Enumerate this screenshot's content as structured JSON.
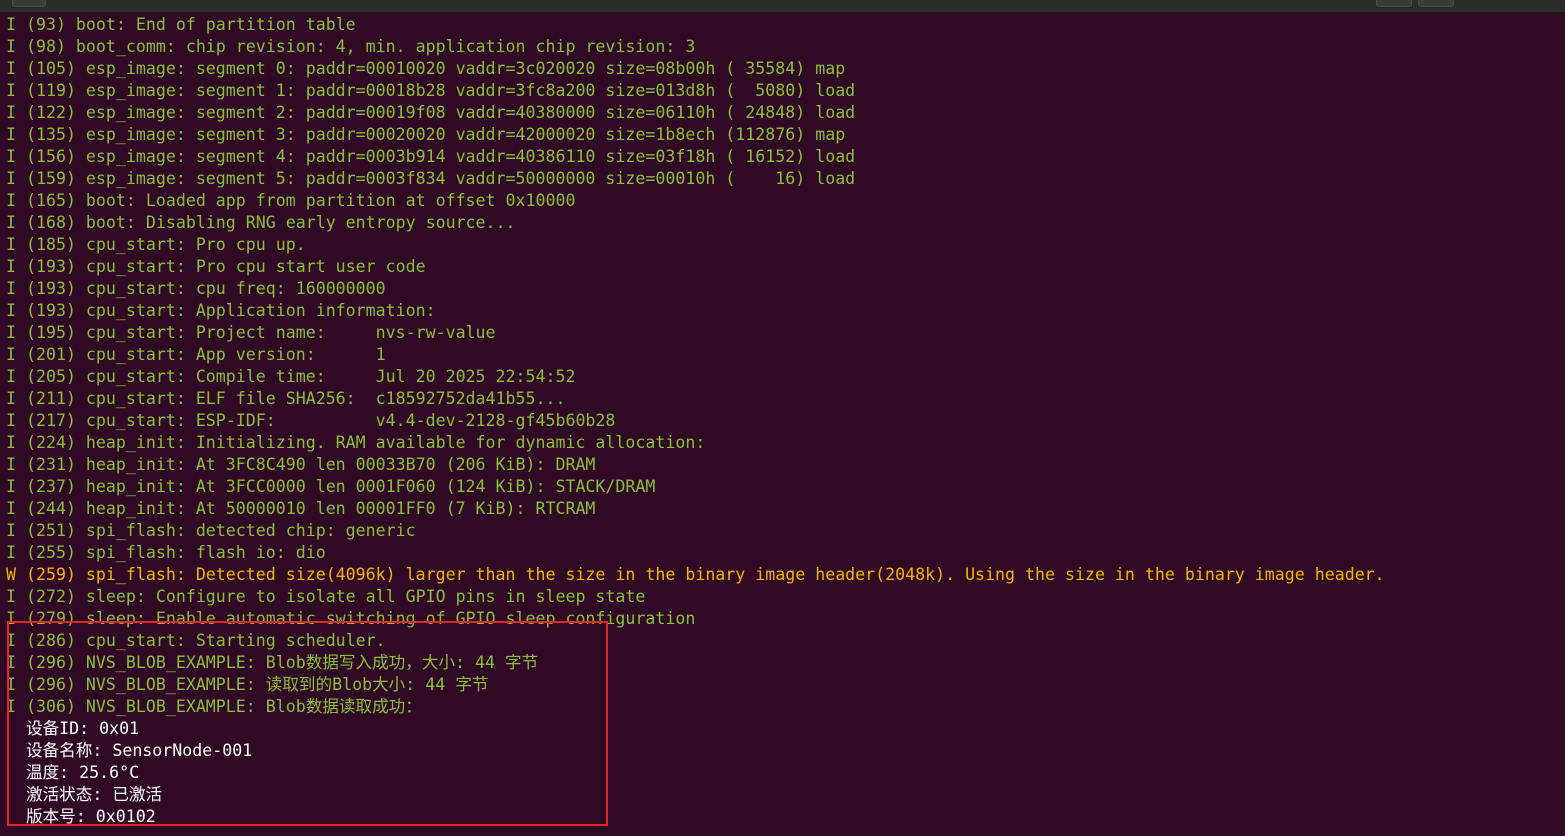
{
  "terminal": {
    "lines": [
      {
        "text": "I (93) boot: End of partition table",
        "level": "info"
      },
      {
        "text": "I (98) boot_comm: chip revision: 4, min. application chip revision: 3",
        "level": "info"
      },
      {
        "text": "I (105) esp_image: segment 0: paddr=00010020 vaddr=3c020020 size=08b00h ( 35584) map",
        "level": "info"
      },
      {
        "text": "I (119) esp_image: segment 1: paddr=00018b28 vaddr=3fc8a200 size=013d8h (  5080) load",
        "level": "info"
      },
      {
        "text": "I (122) esp_image: segment 2: paddr=00019f08 vaddr=40380000 size=06110h ( 24848) load",
        "level": "info"
      },
      {
        "text": "I (135) esp_image: segment 3: paddr=00020020 vaddr=42000020 size=1b8ech (112876) map",
        "level": "info"
      },
      {
        "text": "I (156) esp_image: segment 4: paddr=0003b914 vaddr=40386110 size=03f18h ( 16152) load",
        "level": "info"
      },
      {
        "text": "I (159) esp_image: segment 5: paddr=0003f834 vaddr=50000000 size=00010h (    16) load",
        "level": "info"
      },
      {
        "text": "I (165) boot: Loaded app from partition at offset 0x10000",
        "level": "info"
      },
      {
        "text": "I (168) boot: Disabling RNG early entropy source...",
        "level": "info"
      },
      {
        "text": "I (185) cpu_start: Pro cpu up.",
        "level": "info"
      },
      {
        "text": "I (193) cpu_start: Pro cpu start user code",
        "level": "info"
      },
      {
        "text": "I (193) cpu_start: cpu freq: 160000000",
        "level": "info"
      },
      {
        "text": "I (193) cpu_start: Application information:",
        "level": "info"
      },
      {
        "text": "I (195) cpu_start: Project name:     nvs-rw-value",
        "level": "info"
      },
      {
        "text": "I (201) cpu_start: App version:      1",
        "level": "info"
      },
      {
        "text": "I (205) cpu_start: Compile time:     Jul 20 2025 22:54:52",
        "level": "info"
      },
      {
        "text": "I (211) cpu_start: ELF file SHA256:  c18592752da41b55...",
        "level": "info"
      },
      {
        "text": "I (217) cpu_start: ESP-IDF:          v4.4-dev-2128-gf45b60b28",
        "level": "info"
      },
      {
        "text": "I (224) heap_init: Initializing. RAM available for dynamic allocation:",
        "level": "info"
      },
      {
        "text": "I (231) heap_init: At 3FC8C490 len 00033B70 (206 KiB): DRAM",
        "level": "info"
      },
      {
        "text": "I (237) heap_init: At 3FCC0000 len 0001F060 (124 KiB): STACK/DRAM",
        "level": "info"
      },
      {
        "text": "I (244) heap_init: At 50000010 len 00001FF0 (7 KiB): RTCRAM",
        "level": "info"
      },
      {
        "text": "I (251) spi_flash: detected chip: generic",
        "level": "info"
      },
      {
        "text": "I (255) spi_flash: flash io: dio",
        "level": "info"
      },
      {
        "text": "W (259) spi_flash: Detected size(4096k) larger than the size in the binary image header(2048k). Using the size in the binary image header.",
        "level": "warn"
      },
      {
        "text": "I (272) sleep: Configure to isolate all GPIO pins in sleep state",
        "level": "info"
      },
      {
        "text": "I (279) sleep: Enable automatic switching of GPIO sleep configuration",
        "level": "info"
      },
      {
        "text": "I (286) cpu_start: Starting scheduler.",
        "level": "info"
      },
      {
        "text": "I (296) NVS_BLOB_EXAMPLE: Blob数据写入成功，大小: 44 字节",
        "level": "info"
      },
      {
        "text": "I (296) NVS_BLOB_EXAMPLE: 读取到的Blob大小: 44 字节",
        "level": "info"
      },
      {
        "text": "I (306) NVS_BLOB_EXAMPLE: Blob数据读取成功：",
        "level": "info"
      },
      {
        "text": "  设备ID: 0x01",
        "level": "plain"
      },
      {
        "text": "  设备名称: SensorNode-001",
        "level": "plain"
      },
      {
        "text": "  温度: 25.6°C",
        "level": "plain"
      },
      {
        "text": "  激活状态: 已激活",
        "level": "plain"
      },
      {
        "text": "  版本号: 0x0102",
        "level": "plain"
      }
    ]
  },
  "colors": {
    "background": "#300a24",
    "info": "#8bbd3a",
    "warn": "#f0b400",
    "plain": "#ffffff",
    "highlight": "#e3262c"
  }
}
